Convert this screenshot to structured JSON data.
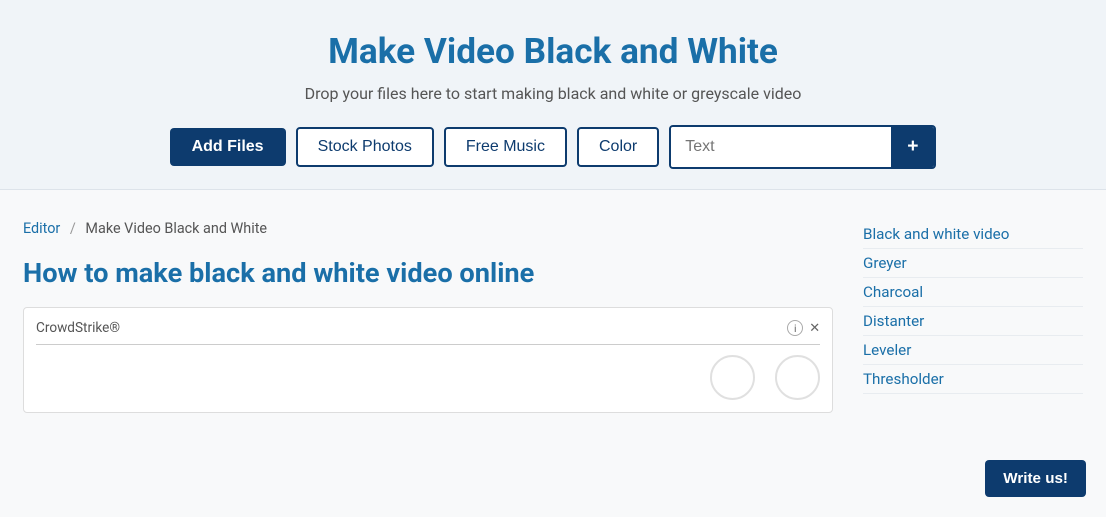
{
  "header": {
    "title": "Make Video Black and White",
    "subtitle": "Drop your files here to start making black and white or greyscale video"
  },
  "toolbar": {
    "add_files_label": "Add Files",
    "stock_photos_label": "Stock Photos",
    "free_music_label": "Free Music",
    "color_label": "Color",
    "text_placeholder": "Text",
    "plus_label": "+"
  },
  "breadcrumb": {
    "editor_label": "Editor",
    "separator": "/",
    "current": "Make Video Black and White"
  },
  "article": {
    "title": "How to make black and white video online"
  },
  "ad": {
    "label": "CrowdStrike®"
  },
  "sidebar": {
    "links": [
      {
        "label": "Black and white video"
      },
      {
        "label": "Greyer"
      },
      {
        "label": "Charcoal"
      },
      {
        "label": "Distanter"
      },
      {
        "label": "Leveler"
      },
      {
        "label": "Thresholder"
      }
    ]
  },
  "write_us": {
    "label": "Write us!"
  }
}
